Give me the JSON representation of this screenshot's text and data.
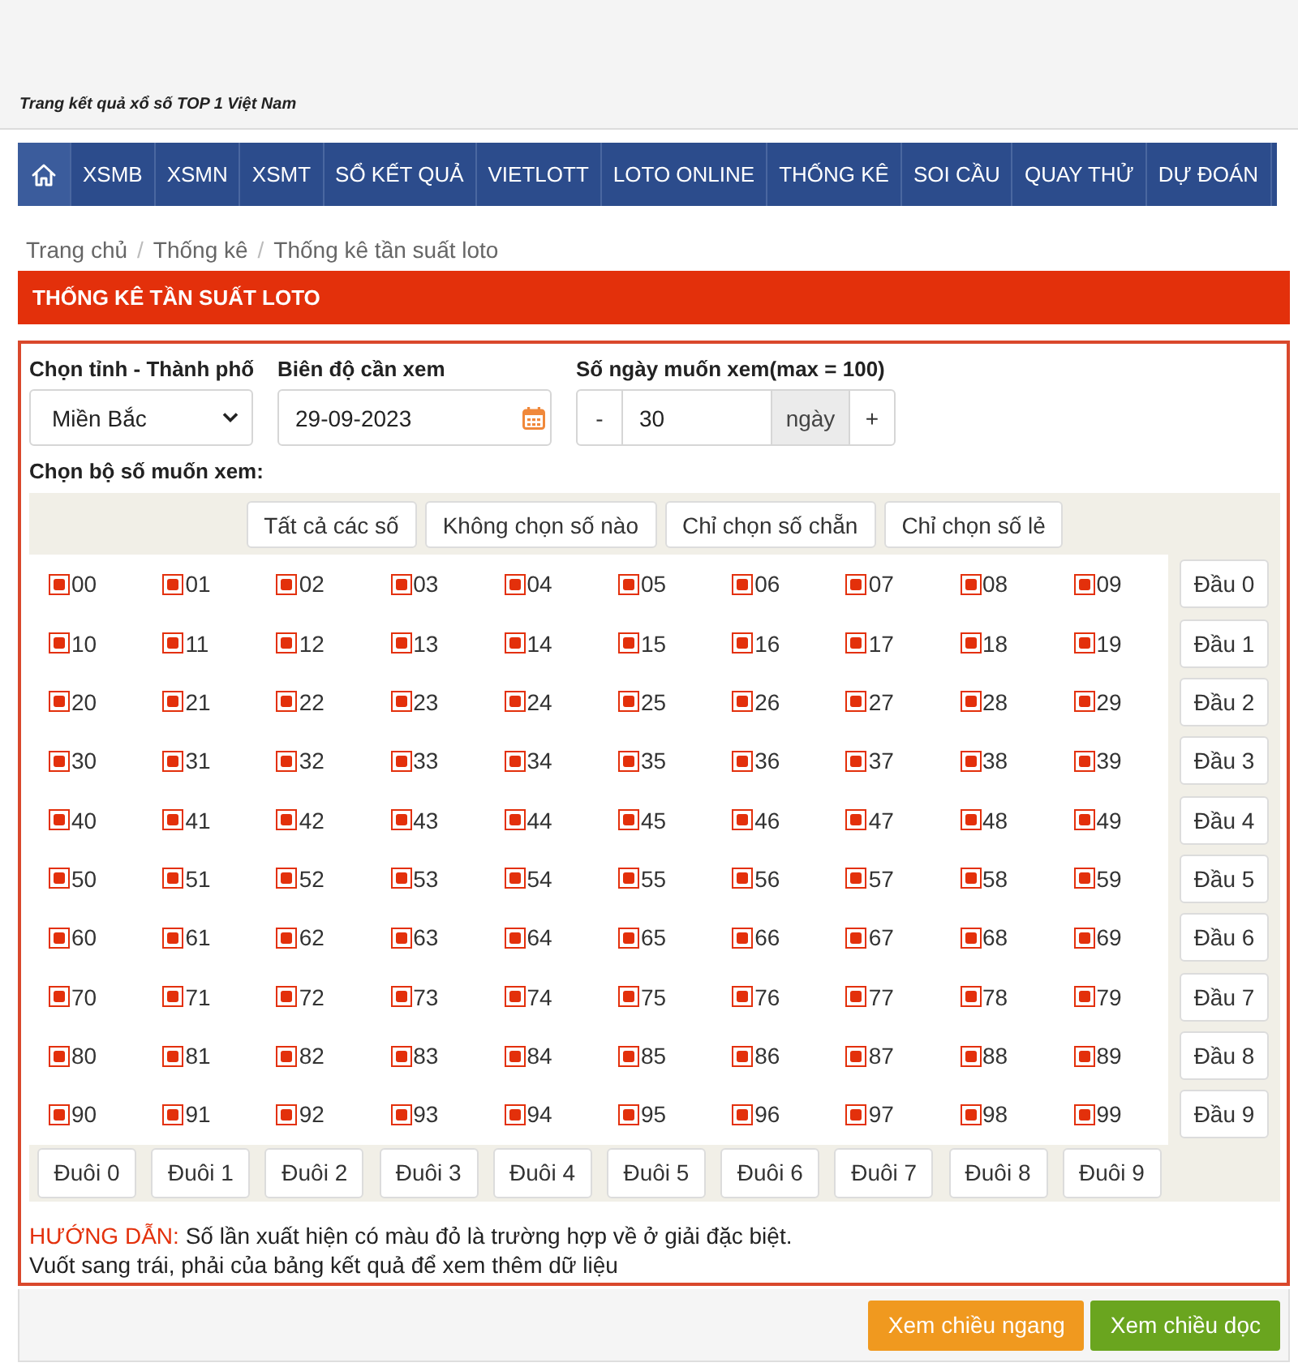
{
  "header": {
    "tagline": "Trang kết quả xổ số TOP 1 Việt Nam"
  },
  "nav": {
    "items": [
      {
        "kind": "home",
        "selected": true
      },
      {
        "kind": "text",
        "label": "XSMB",
        "selected": false
      },
      {
        "kind": "text",
        "label": "XSMN",
        "selected": false
      },
      {
        "kind": "text",
        "label": "XSMT",
        "selected": false
      },
      {
        "kind": "text",
        "label": "SỔ KẾT QUẢ",
        "selected": false
      },
      {
        "kind": "text",
        "label": "VIETLOTT",
        "selected": false
      },
      {
        "kind": "text",
        "label": "LOTO ONLINE",
        "selected": false
      },
      {
        "kind": "text",
        "label": "THỐNG KÊ",
        "selected": false
      },
      {
        "kind": "text",
        "label": "SOI CẦU",
        "selected": false
      },
      {
        "kind": "text",
        "label": "QUAY THỬ",
        "selected": false
      },
      {
        "kind": "text",
        "label": "DỰ ĐOÁN",
        "selected": false
      }
    ]
  },
  "breadcrumb": {
    "separator": "/",
    "items": [
      "Trang chủ",
      "Thống kê",
      "Thống kê tần suất loto"
    ]
  },
  "title": "THỐNG KÊ TẦN SUẤT LOTO",
  "form": {
    "province": {
      "label": "Chọn tỉnh - Thành phố",
      "value": "Miền Bắc"
    },
    "date": {
      "label": "Biên độ cần xem",
      "value": "29-09-2023"
    },
    "days": {
      "label": "Số ngày muốn xem(max = 100)",
      "minus": "-",
      "value": "30",
      "unit": "ngày",
      "plus": "+"
    },
    "number_set_label": "Chọn bộ số muốn xem:"
  },
  "quick_select": [
    "Tất cả các số",
    "Không chọn số nào",
    "Chỉ chọn số chẵn",
    "Chỉ chọn số lẻ"
  ],
  "grid": {
    "rows": [
      {
        "head_button": "Đầu 0",
        "numbers": [
          {
            "label": "00",
            "checked": true
          },
          {
            "label": "01",
            "checked": true
          },
          {
            "label": "02",
            "checked": true
          },
          {
            "label": "03",
            "checked": true
          },
          {
            "label": "04",
            "checked": true
          },
          {
            "label": "05",
            "checked": true
          },
          {
            "label": "06",
            "checked": true
          },
          {
            "label": "07",
            "checked": true
          },
          {
            "label": "08",
            "checked": true
          },
          {
            "label": "09",
            "checked": true
          }
        ]
      },
      {
        "head_button": "Đầu 1",
        "numbers": [
          {
            "label": "10",
            "checked": true
          },
          {
            "label": "11",
            "checked": true
          },
          {
            "label": "12",
            "checked": true
          },
          {
            "label": "13",
            "checked": true
          },
          {
            "label": "14",
            "checked": true
          },
          {
            "label": "15",
            "checked": true
          },
          {
            "label": "16",
            "checked": true
          },
          {
            "label": "17",
            "checked": true
          },
          {
            "label": "18",
            "checked": true
          },
          {
            "label": "19",
            "checked": true
          }
        ]
      },
      {
        "head_button": "Đầu 2",
        "numbers": [
          {
            "label": "20",
            "checked": true
          },
          {
            "label": "21",
            "checked": true
          },
          {
            "label": "22",
            "checked": true
          },
          {
            "label": "23",
            "checked": true
          },
          {
            "label": "24",
            "checked": true
          },
          {
            "label": "25",
            "checked": true
          },
          {
            "label": "26",
            "checked": true
          },
          {
            "label": "27",
            "checked": true
          },
          {
            "label": "28",
            "checked": true
          },
          {
            "label": "29",
            "checked": true
          }
        ]
      },
      {
        "head_button": "Đầu 3",
        "numbers": [
          {
            "label": "30",
            "checked": true
          },
          {
            "label": "31",
            "checked": true
          },
          {
            "label": "32",
            "checked": true
          },
          {
            "label": "33",
            "checked": true
          },
          {
            "label": "34",
            "checked": true
          },
          {
            "label": "35",
            "checked": true
          },
          {
            "label": "36",
            "checked": true
          },
          {
            "label": "37",
            "checked": true
          },
          {
            "label": "38",
            "checked": true
          },
          {
            "label": "39",
            "checked": true
          }
        ]
      },
      {
        "head_button": "Đầu 4",
        "numbers": [
          {
            "label": "40",
            "checked": true
          },
          {
            "label": "41",
            "checked": true
          },
          {
            "label": "42",
            "checked": true
          },
          {
            "label": "43",
            "checked": true
          },
          {
            "label": "44",
            "checked": true
          },
          {
            "label": "45",
            "checked": true
          },
          {
            "label": "46",
            "checked": true
          },
          {
            "label": "47",
            "checked": true
          },
          {
            "label": "48",
            "checked": true
          },
          {
            "label": "49",
            "checked": true
          }
        ]
      },
      {
        "head_button": "Đầu 5",
        "numbers": [
          {
            "label": "50",
            "checked": true
          },
          {
            "label": "51",
            "checked": true
          },
          {
            "label": "52",
            "checked": true
          },
          {
            "label": "53",
            "checked": true
          },
          {
            "label": "54",
            "checked": true
          },
          {
            "label": "55",
            "checked": true
          },
          {
            "label": "56",
            "checked": true
          },
          {
            "label": "57",
            "checked": true
          },
          {
            "label": "58",
            "checked": true
          },
          {
            "label": "59",
            "checked": true
          }
        ]
      },
      {
        "head_button": "Đầu 6",
        "numbers": [
          {
            "label": "60",
            "checked": true
          },
          {
            "label": "61",
            "checked": true
          },
          {
            "label": "62",
            "checked": true
          },
          {
            "label": "63",
            "checked": true
          },
          {
            "label": "64",
            "checked": true
          },
          {
            "label": "65",
            "checked": true
          },
          {
            "label": "66",
            "checked": true
          },
          {
            "label": "67",
            "checked": true
          },
          {
            "label": "68",
            "checked": true
          },
          {
            "label": "69",
            "checked": true
          }
        ]
      },
      {
        "head_button": "Đầu 7",
        "numbers": [
          {
            "label": "70",
            "checked": true
          },
          {
            "label": "71",
            "checked": true
          },
          {
            "label": "72",
            "checked": true
          },
          {
            "label": "73",
            "checked": true
          },
          {
            "label": "74",
            "checked": true
          },
          {
            "label": "75",
            "checked": true
          },
          {
            "label": "76",
            "checked": true
          },
          {
            "label": "77",
            "checked": true
          },
          {
            "label": "78",
            "checked": true
          },
          {
            "label": "79",
            "checked": true
          }
        ]
      },
      {
        "head_button": "Đầu 8",
        "numbers": [
          {
            "label": "80",
            "checked": true
          },
          {
            "label": "81",
            "checked": true
          },
          {
            "label": "82",
            "checked": true
          },
          {
            "label": "83",
            "checked": true
          },
          {
            "label": "84",
            "checked": true
          },
          {
            "label": "85",
            "checked": true
          },
          {
            "label": "86",
            "checked": true
          },
          {
            "label": "87",
            "checked": true
          },
          {
            "label": "88",
            "checked": true
          },
          {
            "label": "89",
            "checked": true
          }
        ]
      },
      {
        "head_button": "Đầu 9",
        "numbers": [
          {
            "label": "90",
            "checked": true
          },
          {
            "label": "91",
            "checked": true
          },
          {
            "label": "92",
            "checked": true
          },
          {
            "label": "93",
            "checked": true
          },
          {
            "label": "94",
            "checked": true
          },
          {
            "label": "95",
            "checked": true
          },
          {
            "label": "96",
            "checked": true
          },
          {
            "label": "97",
            "checked": true
          },
          {
            "label": "98",
            "checked": true
          },
          {
            "label": "99",
            "checked": true
          }
        ]
      }
    ],
    "tail_buttons": [
      "Đuôi 0",
      "Đuôi 1",
      "Đuôi 2",
      "Đuôi 3",
      "Đuôi 4",
      "Đuôi 5",
      "Đuôi 6",
      "Đuôi 7",
      "Đuôi 8",
      "Đuôi 9"
    ]
  },
  "guide": {
    "label": "HƯỚNG DẪN:",
    "lines": [
      "Số lần xuất hiện có màu đỏ là trường hợp về ở giải đặc biệt.",
      "Vuốt sang trái, phải của bảng kết quả để xem thêm dữ liệu"
    ]
  },
  "view_buttons": [
    {
      "label": "Xem chiều ngang",
      "color": "#f0991f"
    },
    {
      "label": "Xem chiều dọc",
      "color": "#6aa51f"
    }
  ]
}
